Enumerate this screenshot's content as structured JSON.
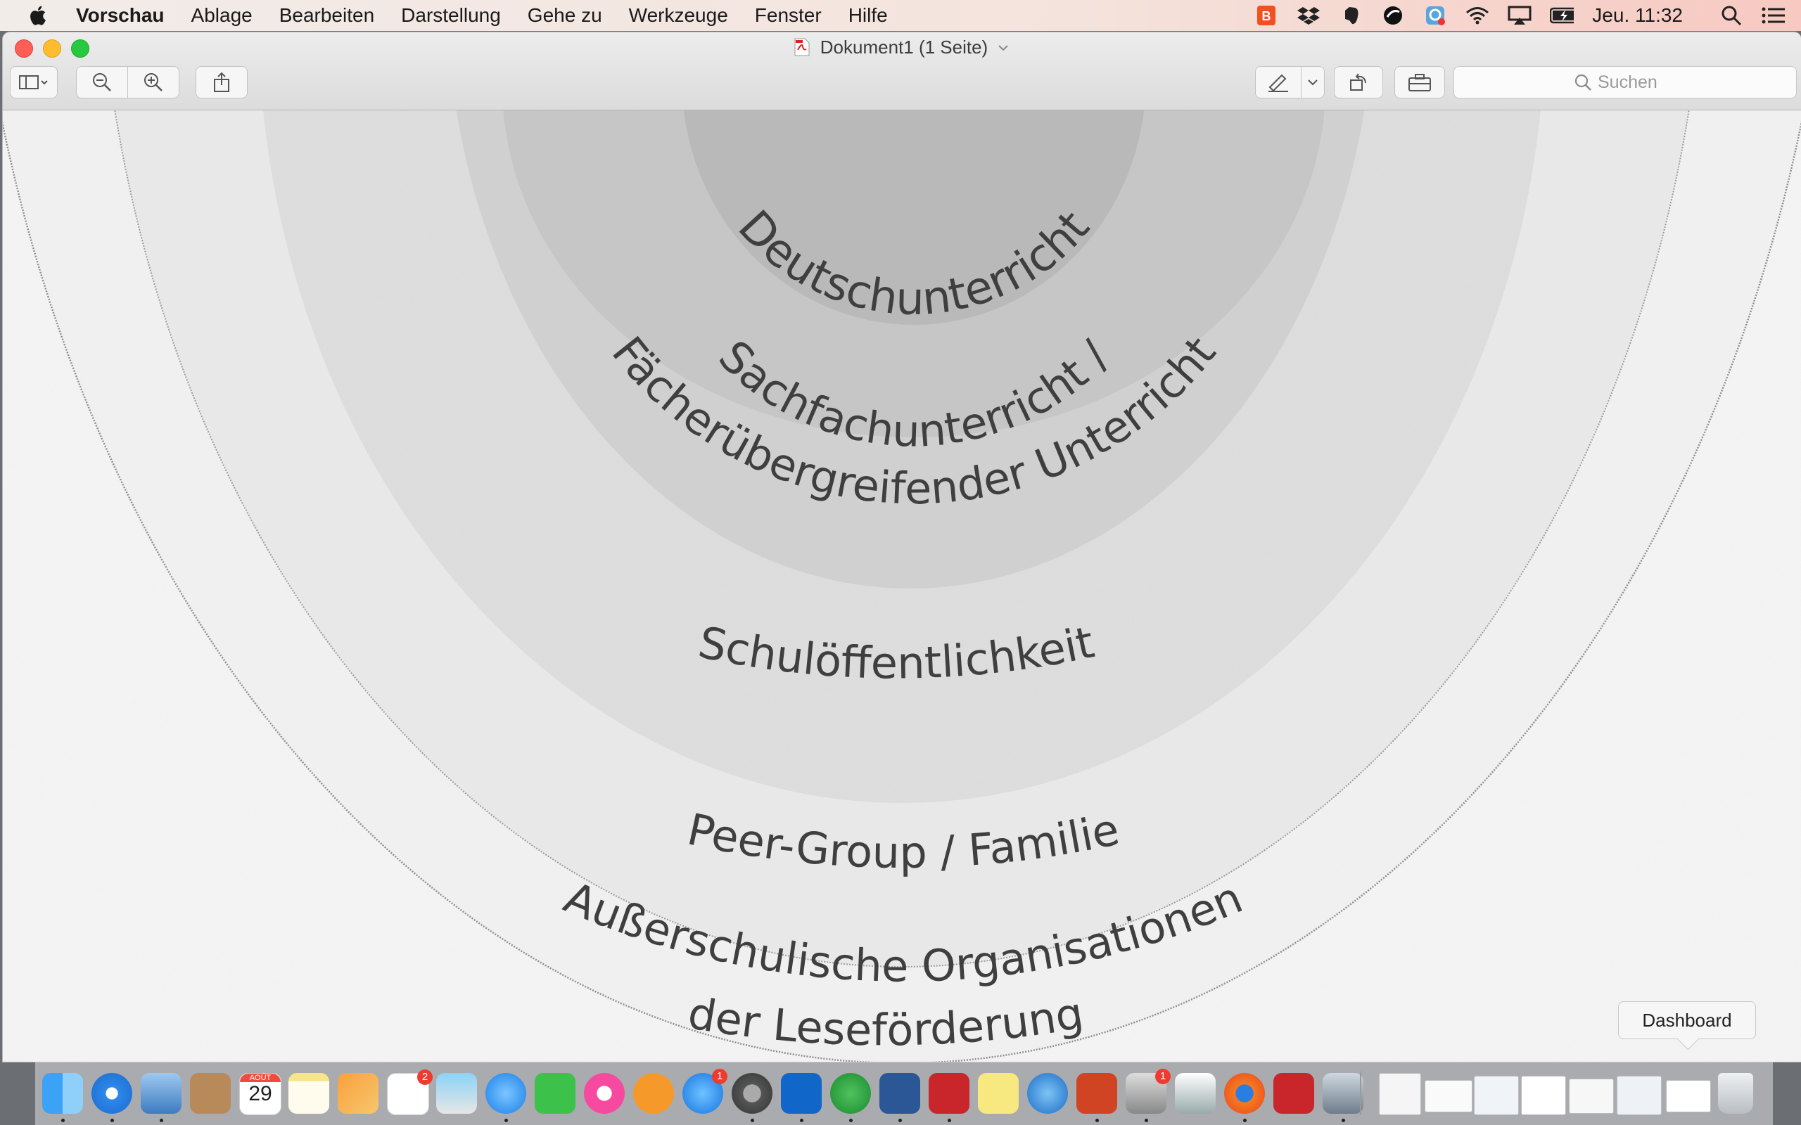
{
  "menubar": {
    "app_name": "Vorschau",
    "items": [
      "Ablage",
      "Bearbeiten",
      "Darstellung",
      "Gehe zu",
      "Werkzeuge",
      "Fenster",
      "Hilfe"
    ],
    "clock": "Jeu. 11:32",
    "status_icons": [
      "brave-icon",
      "dropbox-icon",
      "evernote-icon",
      "sync-icon",
      "network-icon",
      "wifi-icon",
      "airplay-icon",
      "battery-icon",
      "spotlight-icon",
      "notification-center-icon"
    ]
  },
  "window": {
    "title": "Dokument1 (1 Seite)",
    "search_placeholder": "Suchen"
  },
  "document": {
    "rings": [
      {
        "lines": [
          "Deutschunterricht"
        ]
      },
      {
        "lines": [
          "Sachfachunterricht /",
          "Fächerübergreifender Unterricht"
        ]
      },
      {
        "lines": [
          "Schulöffentlichkeit"
        ]
      },
      {
        "lines": [
          "Peer-Group / Familie"
        ]
      },
      {
        "lines": [
          "Außerschulische Organisationen",
          "der Leseförderung"
        ]
      }
    ]
  },
  "dock": {
    "tooltip": "Dashboard",
    "badges": {
      "reminders": "2",
      "app_store": "1",
      "preview_alert": "1"
    },
    "apps": [
      "finder-icon",
      "safari-icon",
      "preview-app-icon",
      "contacts-icon",
      "calendar-icon",
      "notes-icon",
      "pages-icon",
      "reminders-icon",
      "photo-icon",
      "messages-icon",
      "facetime-icon",
      "itunes-icon",
      "ibooks-icon",
      "app-store-icon",
      "system-preferences-icon",
      "outlook-icon",
      "evernote-icon",
      "word-icon",
      "zotero-icon",
      "stickies-icon",
      "dashboard-icon",
      "powerpoint-icon",
      "printer-icon",
      "dictionary-icon",
      "firefox-icon",
      "zotero-alt-icon",
      "image-capture-icon",
      "document-thumb-icon",
      "document-thumb-icon",
      "document-thumb-icon",
      "document-thumb-icon",
      "document-thumb-icon",
      "document-thumb-icon",
      "document-thumb-icon",
      "trash-icon"
    ],
    "calendar": {
      "month": "AOÛT",
      "day": "29"
    }
  }
}
